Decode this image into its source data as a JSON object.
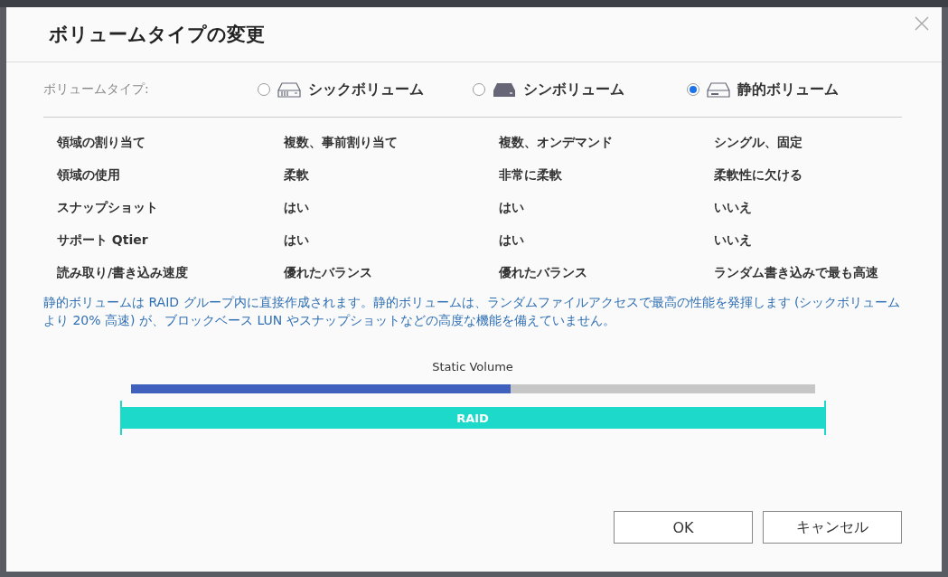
{
  "dialog": {
    "title": "ボリュームタイプの変更"
  },
  "volume_type": {
    "label": "ボリュームタイプ:",
    "options": [
      {
        "label": "シックボリューム",
        "kind": "thick",
        "selected": false
      },
      {
        "label": "シンボリューム",
        "kind": "thin",
        "selected": false
      },
      {
        "label": "静的ボリューム",
        "kind": "static",
        "selected": true
      }
    ]
  },
  "comparison": {
    "rows": [
      [
        "領域の割り当て",
        "複数、事前割り当て",
        "複数、オンデマンド",
        "シングル、固定"
      ],
      [
        "領域の使用",
        "柔軟",
        "非常に柔軟",
        "柔軟性に欠ける"
      ],
      [
        "スナップショット",
        "はい",
        "はい",
        "いいえ"
      ],
      [
        "サポート Qtier",
        "はい",
        "はい",
        "いいえ"
      ],
      [
        "読み取り/書き込み速度",
        "優れたバランス",
        "優れたバランス",
        "ランダム書き込みで最も高速"
      ]
    ]
  },
  "description": "静的ボリュームは RAID グループ内に直接作成されます。静的ボリュームは、ランダムファイルアクセスで最高の性能を発揮します (シックボリュームより 20% 高速) が、ブロックベース LUN やスナップショットなどの高度な機能を備えていません。",
  "diagram": {
    "volume_label": "Static Volume",
    "level": 0.555,
    "raid_label": "RAID"
  },
  "buttons": [
    "OK",
    "キャンセル"
  ]
}
